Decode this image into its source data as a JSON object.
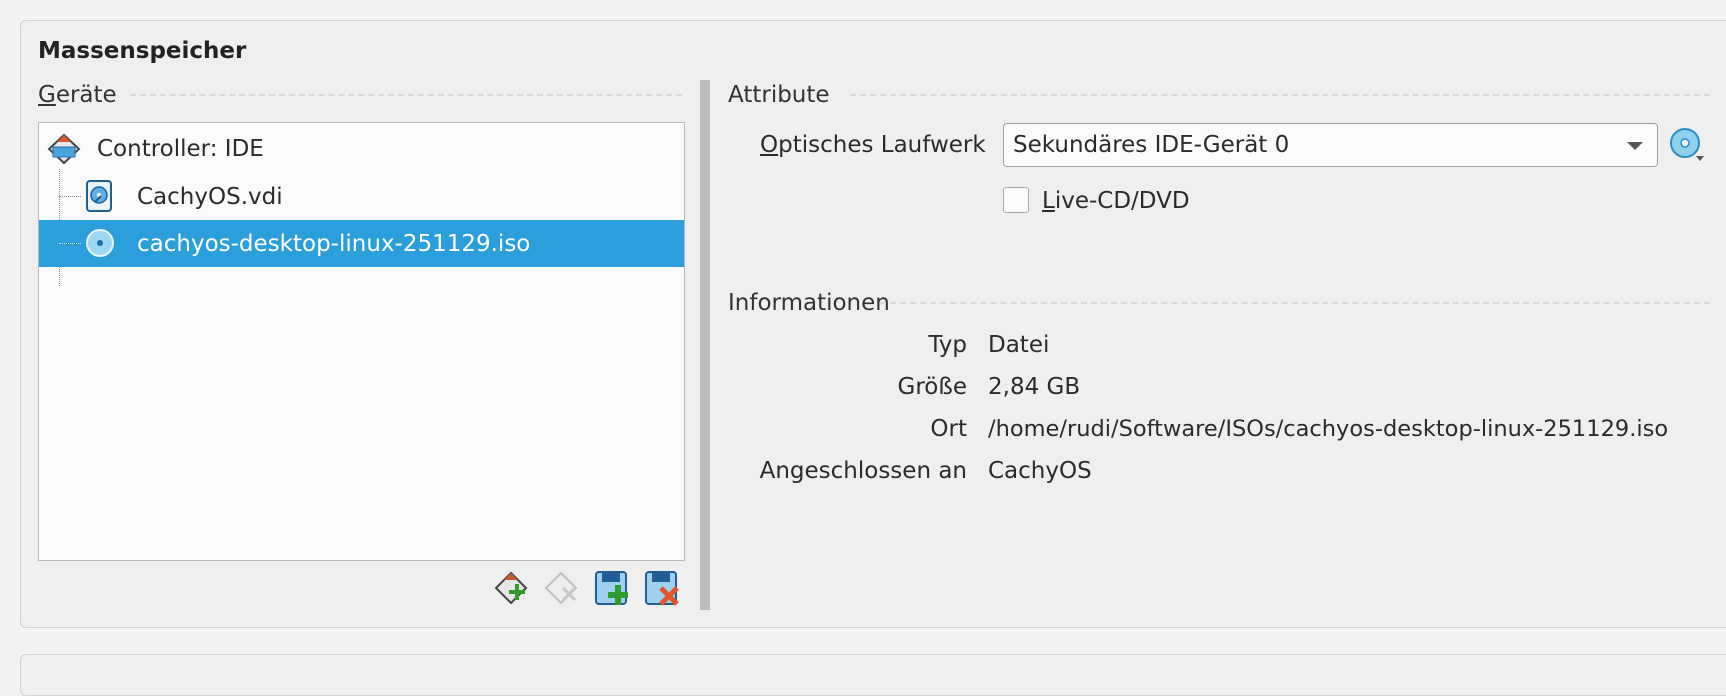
{
  "title": "Massenspeicher",
  "devices": {
    "label": "Geräte",
    "tree": [
      {
        "label": "Controller: IDE",
        "icon": "ide-controller-icon",
        "selected": false
      },
      {
        "label": "CachyOS.vdi",
        "icon": "hard-disk-icon",
        "selected": false
      },
      {
        "label": "cachyos-desktop-linux-251129.iso",
        "icon": "optical-disc-icon",
        "selected": true
      }
    ],
    "toolbar": [
      {
        "name": "add-controller-button",
        "icon": "add-controller-icon",
        "enabled": true
      },
      {
        "name": "remove-controller-button",
        "icon": "remove-controller-icon",
        "enabled": false
      },
      {
        "name": "add-attachment-button",
        "icon": "add-attachment-icon",
        "enabled": true
      },
      {
        "name": "remove-attachment-button",
        "icon": "remove-attachment-icon",
        "enabled": true
      }
    ]
  },
  "attributes": {
    "label": "Attribute",
    "optical_drive_label": "Optisches Laufwerk",
    "optical_drive_value": "Sekundäres IDE-Gerät 0",
    "live_cd_label": "Live-CD/DVD",
    "live_cd_checked": false
  },
  "information": {
    "label": "Informationen",
    "rows": [
      {
        "key": "Typ",
        "value": "Datei"
      },
      {
        "key": "Größe",
        "value": "2,84 GB"
      },
      {
        "key": "Ort",
        "value": "/home/rudi/Software/ISOs/cachyos-desktop-linux-251129.iso"
      },
      {
        "key": "Angeschlossen an",
        "value": "CachyOS"
      }
    ]
  },
  "colors": {
    "selection": "#2b9fdb",
    "accent": "#2b9fdb"
  }
}
